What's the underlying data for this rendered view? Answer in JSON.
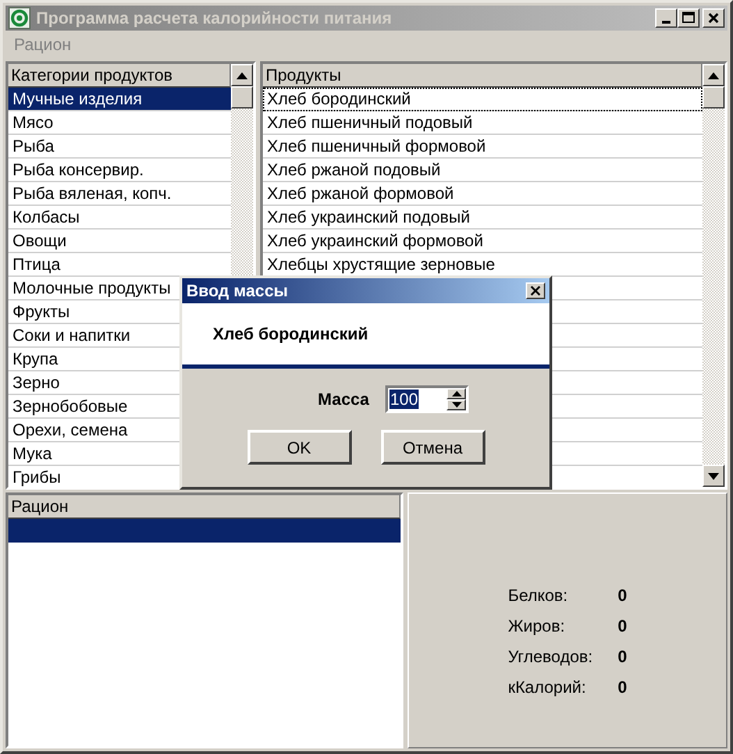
{
  "window": {
    "title": "Программа расчета калорийности питания",
    "active": false
  },
  "menu": [
    "Рацион"
  ],
  "categories": {
    "header": "Категории продуктов",
    "items": [
      {
        "label": "Мучные изделия",
        "selected": true
      },
      {
        "label": "Мясо",
        "selected": false
      },
      {
        "label": "Рыба",
        "selected": false
      },
      {
        "label": "Рыба консервир.",
        "selected": false
      },
      {
        "label": "Рыба вяленая, копч.",
        "selected": false
      },
      {
        "label": "Колбасы",
        "selected": false
      },
      {
        "label": "Овощи",
        "selected": false
      },
      {
        "label": "Птица",
        "selected": false
      },
      {
        "label": "Молочные продукты",
        "selected": false
      },
      {
        "label": "Фрукты",
        "selected": false
      },
      {
        "label": "Соки и напитки",
        "selected": false
      },
      {
        "label": "Крупа",
        "selected": false
      },
      {
        "label": "Зерно",
        "selected": false
      },
      {
        "label": "Зернобобовые",
        "selected": false
      },
      {
        "label": "Орехи, семена",
        "selected": false
      },
      {
        "label": "Мука",
        "selected": false
      },
      {
        "label": "Грибы",
        "selected": false
      }
    ]
  },
  "products": {
    "header": "Продукты",
    "items": [
      {
        "label": "Хлеб бородинский",
        "selected": true
      },
      {
        "label": "Хлеб пшеничный подовый",
        "selected": false
      },
      {
        "label": "Хлеб пшеничный формовой",
        "selected": false
      },
      {
        "label": "Хлеб ржаной подовый",
        "selected": false
      },
      {
        "label": "Хлеб ржаной формовой",
        "selected": false
      },
      {
        "label": "Хлеб украинский подовый",
        "selected": false
      },
      {
        "label": "Хлеб украинский формовой",
        "selected": false
      },
      {
        "label": "Хлебцы хрустящие зерновые",
        "selected": false
      }
    ]
  },
  "diet": {
    "header": "Рацион",
    "rows": [
      {
        "selected": true
      }
    ]
  },
  "totals": [
    {
      "label": "Белков:",
      "value": "0"
    },
    {
      "label": "Жиров:",
      "value": "0"
    },
    {
      "label": "Углеводов:",
      "value": "0"
    },
    {
      "label": "кКалорий:",
      "value": "0"
    }
  ],
  "dialog": {
    "title": "Ввод массы",
    "product": "Хлеб бородинский",
    "mass_label": "Масса",
    "mass_value": "100",
    "buttons": [
      "OK",
      "Отмена"
    ]
  }
}
